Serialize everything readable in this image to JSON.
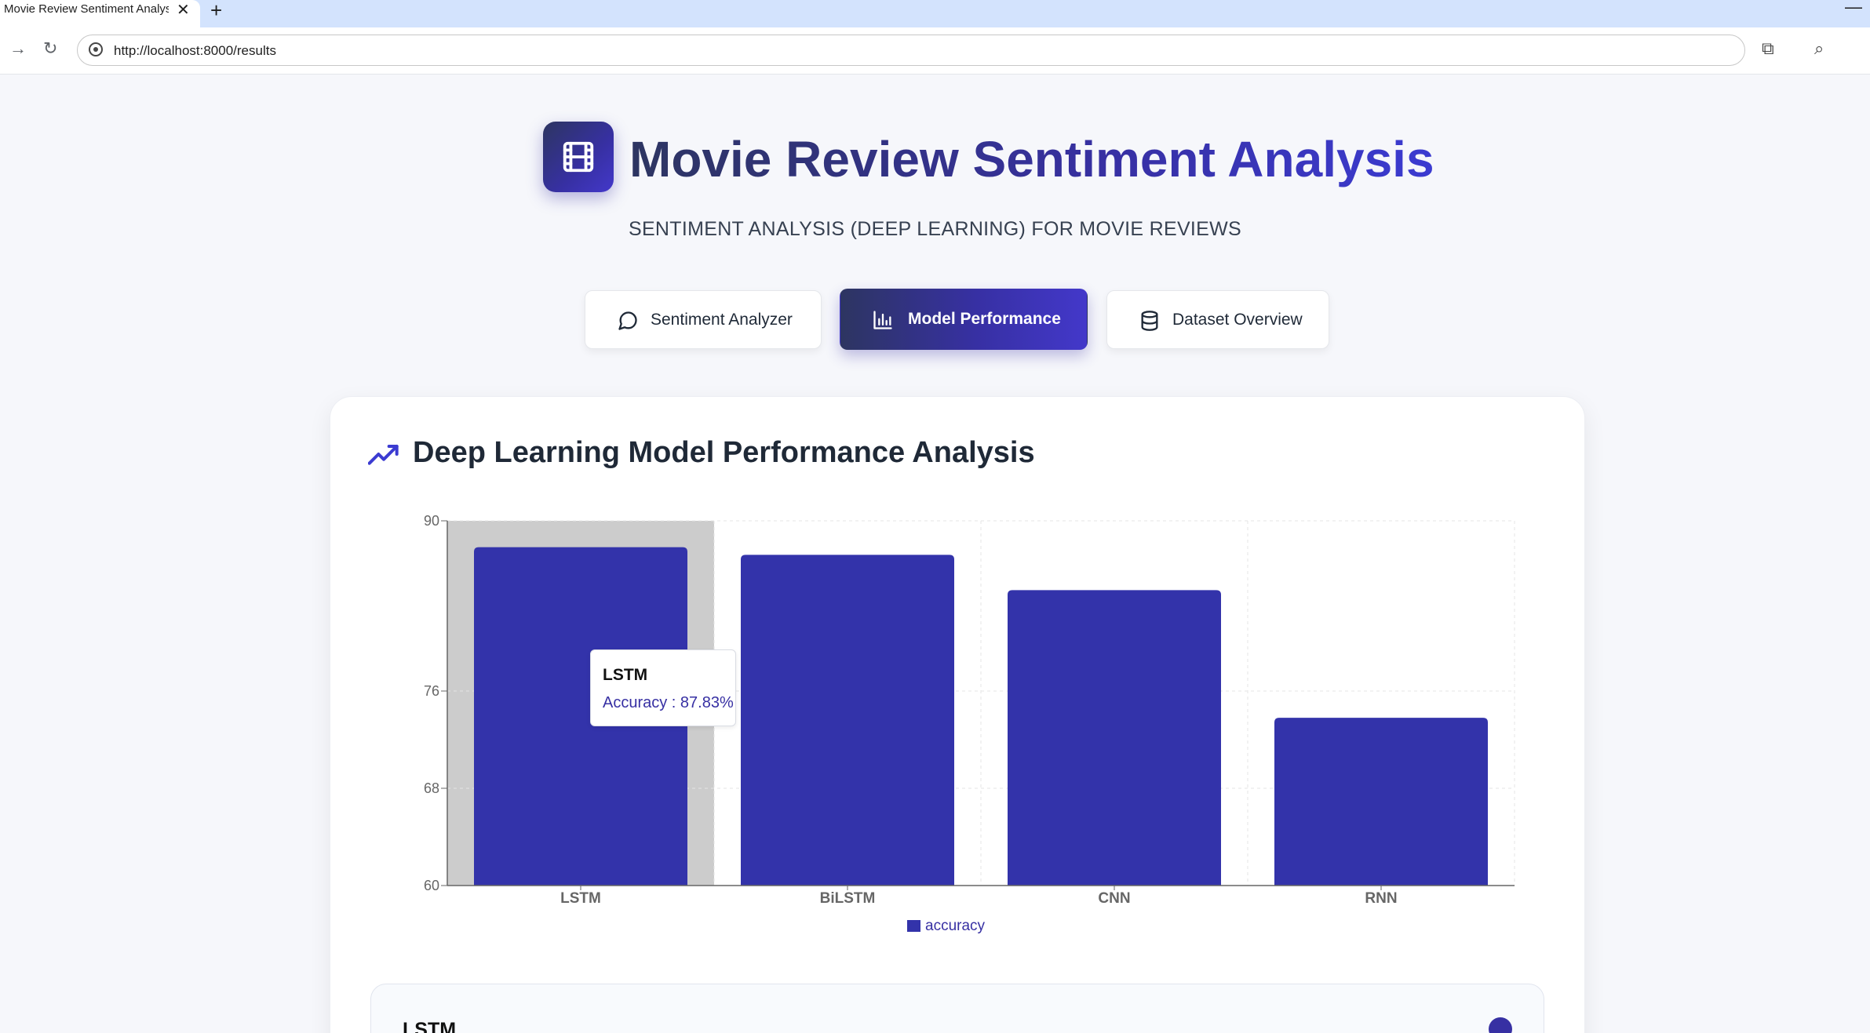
{
  "browser": {
    "tab_title": "Movie Review Sentiment Analysis",
    "url": "http://localhost:8000/results"
  },
  "header": {
    "logo_icon": "film-icon",
    "title": "Movie Review Sentiment Analysis",
    "subtitle": "SENTIMENT ANALYSIS (DEEP LEARNING) FOR MOVIE REVIEWS"
  },
  "nav": {
    "items": [
      {
        "label": "Sentiment Analyzer",
        "icon": "message-circle-icon",
        "active": false
      },
      {
        "label": "Model Performance",
        "icon": "bar-chart-icon",
        "active": true
      },
      {
        "label": "Dataset Overview",
        "icon": "database-icon",
        "active": false
      }
    ]
  },
  "section": {
    "title": "Deep Learning Model Performance Analysis",
    "icon": "trending-up-icon"
  },
  "chart_data": {
    "type": "bar",
    "categories": [
      "LSTM",
      "BiLSTM",
      "CNN",
      "RNN"
    ],
    "series": [
      {
        "name": "accuracy",
        "values": [
          87.83,
          87.2,
          84.3,
          73.8
        ]
      }
    ],
    "ylim": [
      60,
      90
    ],
    "yticks": [
      60,
      68,
      76,
      90
    ],
    "grid": true,
    "legend": "bottom",
    "bar_color": "#3333aa",
    "highlight_category": "LSTM",
    "tooltip": {
      "title": "LSTM",
      "label": "Accuracy : 87.83%"
    }
  },
  "model_card": {
    "name": "LSTM"
  },
  "colors": {
    "accent": "#3730a3",
    "bar": "#3333aa"
  }
}
